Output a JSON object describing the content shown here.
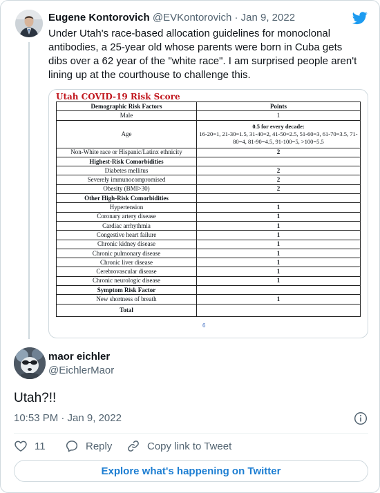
{
  "quoted_tweet": {
    "author_name": "Eugene Kontorovich",
    "author_handle": "@EVKontorovich",
    "separator": "·",
    "date": "Jan 9, 2022",
    "text": "Under Utah's race-based allocation guidelines for monoclonal antibodies, a 25-year old whose parents were born in Cuba gets dibs over a 62 year of the \"white race\". I am surprised people aren't lining up at the courthouse to challenge this."
  },
  "document": {
    "title": "Utah COVID-19 Risk Score",
    "page_number": "6",
    "header": {
      "col1": "Demographic Risk Factors",
      "col2": "Points"
    },
    "rows": [
      {
        "factor": "Male",
        "points": "1"
      },
      {
        "factor": "Age",
        "points_heading": "0.5 for every decade:",
        "points_detail": "16-20=1, 21-30=1.5, 31-40=2, 41-50=2.5, 51-60=3, 61-70=3.5, 71-80=4, 81-90=4.5, 91-100=5, >100=5.5"
      },
      {
        "factor": "Non-White race or Hispanic/Latinx ethnicity",
        "points": "2"
      },
      {
        "section": "Highest-Risk Comorbidities"
      },
      {
        "factor": "Diabetes mellitus",
        "points": "2"
      },
      {
        "factor": "Severely immunocompromised",
        "points": "2"
      },
      {
        "factor": "Obesity (BMI>30)",
        "points": "2"
      },
      {
        "section": "Other High-Risk Comorbidities"
      },
      {
        "factor": "Hypertension",
        "points": "1"
      },
      {
        "factor": "Coronary artery disease",
        "points": "1"
      },
      {
        "factor": "Cardiac arrhythmia",
        "points": "1"
      },
      {
        "factor": "Congestive heart failure",
        "points": "1"
      },
      {
        "factor": "Chronic kidney disease",
        "points": "1"
      },
      {
        "factor": "Chronic pulmonary disease",
        "points": "1"
      },
      {
        "factor": "Chronic liver disease",
        "points": "1"
      },
      {
        "factor": "Cerebrovascular disease",
        "points": "1"
      },
      {
        "factor": "Chronic neurologic disease",
        "points": "1"
      },
      {
        "section": "Symptom Risk Factor"
      },
      {
        "factor": "New shortness of breath",
        "points": "1"
      },
      {
        "total": "Total"
      }
    ]
  },
  "reply_tweet": {
    "author_name": "maor eichler",
    "author_handle": "@EichlerMaor",
    "text": "Utah?!!",
    "timestamp": "10:53 PM · Jan 9, 2022"
  },
  "actions": {
    "like_count": "11",
    "reply_label": "Reply",
    "copy_link_label": "Copy link to Tweet"
  },
  "explore_label": "Explore what's happening on Twitter",
  "icons": {
    "brand": "twitter-bird-icon",
    "like": "heart-icon",
    "reply": "speech-bubble-icon",
    "copy": "link-icon",
    "info": "info-icon"
  },
  "colors": {
    "brand_blue": "#1d9bf0",
    "link_blue": "#1d7ed2",
    "text_secondary": "#536471",
    "document_title_red": "#c0151c"
  }
}
